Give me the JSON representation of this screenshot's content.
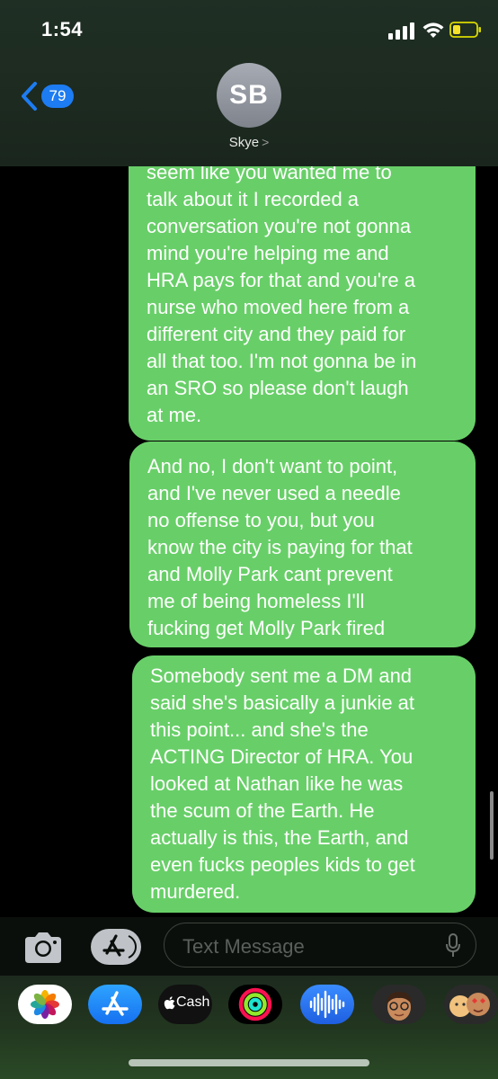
{
  "status_bar": {
    "time": "1:54"
  },
  "header": {
    "back_badge": "79",
    "avatar_initials": "SB",
    "contact_name": "Skye",
    "contact_chevron": ">"
  },
  "messages": [
    {
      "direction": "outgoing",
      "text": "seem like you wanted me to\ntalk about it I recorded a\nconversation you're not gonna\nmind you're helping me and\nHRA pays for that and you're a\nnurse who moved here from a\ndifferent city and they paid for\nall that too. I'm not gonna be in\nan SRO so please don't laugh\nat me."
    },
    {
      "direction": "outgoing",
      "text": "And no, I don't want to point,\nand I've never used a needle\nno offense to you, but you\nknow the city is paying for that\nand Molly Park cant prevent\nme of being homeless I'll\nfucking get Molly Park fired"
    },
    {
      "direction": "outgoing",
      "text": "Somebody sent me a DM and\nsaid she's basically a junkie at\nthis point... and she's the\nACTING Director of HRA. You\nlooked at Nathan like he was\nthe scum of the Earth. He\nactually is this, the Earth, and\neven fucks peoples kids to get\nmurdered."
    }
  ],
  "composer": {
    "placeholder": "Text Message"
  },
  "app_drawer": {
    "cash_label": "Cash",
    "apps": [
      "photos-icon",
      "app-store-icon",
      "apple-cash-icon",
      "activity-icon",
      "audio-message-icon",
      "memoji-icon",
      "memoji-stickers-icon"
    ]
  },
  "colors": {
    "bubble_outgoing": "#68cf68",
    "badge": "#1d7cf2",
    "background": "#000000"
  }
}
